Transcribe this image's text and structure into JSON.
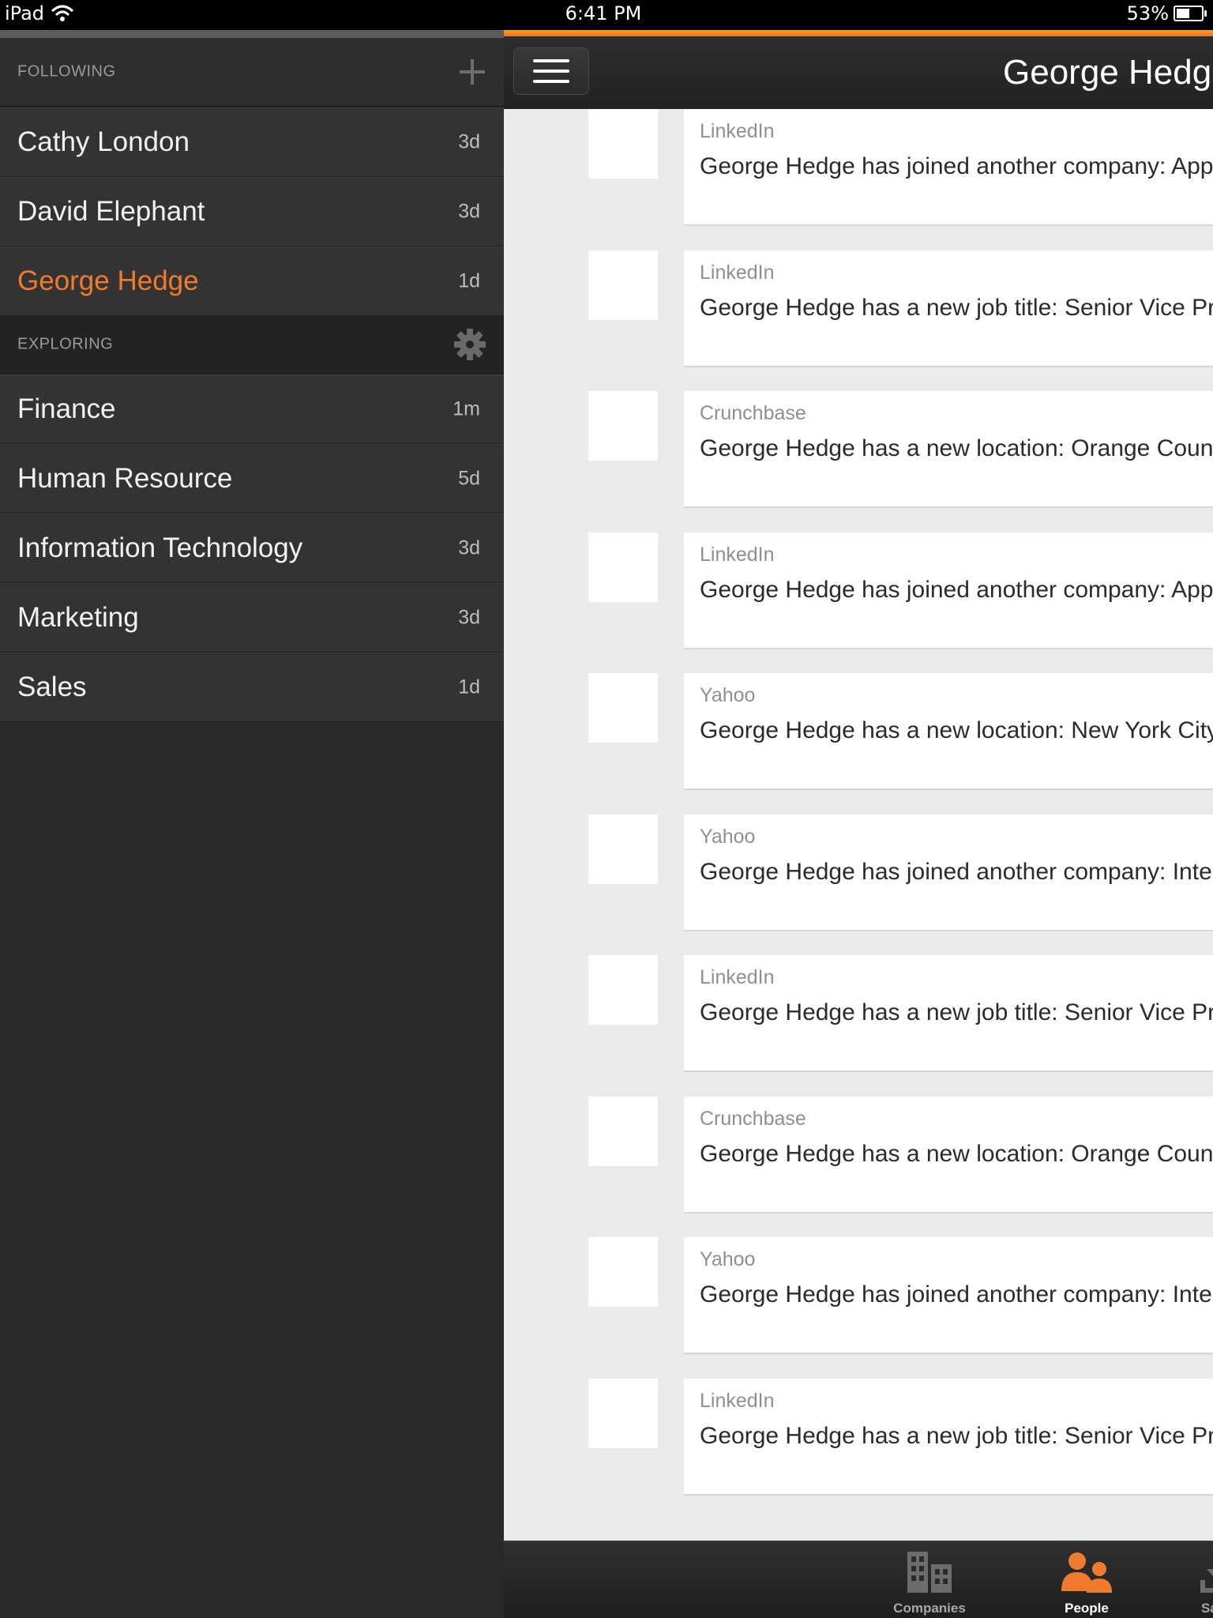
{
  "status_bar": {
    "device": "iPad",
    "time": "6:41 PM",
    "battery": "53%",
    "battery_level": 0.53
  },
  "sidebar": {
    "following": {
      "header": "FOLLOWING",
      "action_icon": "plus-icon",
      "items": [
        {
          "name": "Cathy London",
          "age": "3d"
        },
        {
          "name": "David Elephant",
          "age": "3d"
        },
        {
          "name": "George Hedge",
          "age": "1d",
          "active": true
        }
      ]
    },
    "exploring": {
      "header": "EXPLORING",
      "action_icon": "gear-icon",
      "items": [
        {
          "name": "Finance",
          "age": "1m"
        },
        {
          "name": "Human Resource",
          "age": "5d"
        },
        {
          "name": "Information Technology",
          "age": "3d"
        },
        {
          "name": "Marketing",
          "age": "3d"
        },
        {
          "name": "Sales",
          "age": "1d"
        }
      ]
    }
  },
  "header": {
    "title": "George Hedge",
    "menu_icon": "hamburger-menu-icon"
  },
  "feed": [
    {
      "source": "LinkedIn",
      "text": "George Hedge has joined another company: App"
    },
    {
      "source": "LinkedIn",
      "text": "George Hedge has a new job title: Senior Vice Pr"
    },
    {
      "source": "Crunchbase",
      "text": "George Hedge has a new location: Orange Coun"
    },
    {
      "source": "LinkedIn",
      "text": "George Hedge has joined another company: App"
    },
    {
      "source": "Yahoo",
      "text": "George Hedge has a new location: New York City"
    },
    {
      "source": "Yahoo",
      "text": "George Hedge has joined another company: Inte"
    },
    {
      "source": "LinkedIn",
      "text": "George Hedge has a new job title: Senior Vice Pr"
    },
    {
      "source": "Crunchbase",
      "text": "George Hedge has a new location: Orange Coun"
    },
    {
      "source": "Yahoo",
      "text": "George Hedge has joined another company: Inte"
    },
    {
      "source": "LinkedIn",
      "text": "George Hedge has a new job title: Senior Vice Pr"
    }
  ],
  "tabs": [
    {
      "label": "Companies",
      "icon": "buildings-icon"
    },
    {
      "label": "People",
      "icon": "people-icon",
      "active": true
    },
    {
      "label": "Saved",
      "icon": "download-icon"
    }
  ],
  "colors": {
    "accent": "#f07a2e",
    "sidebar_bg": "#292929",
    "feed_bg": "#ebebeb"
  }
}
